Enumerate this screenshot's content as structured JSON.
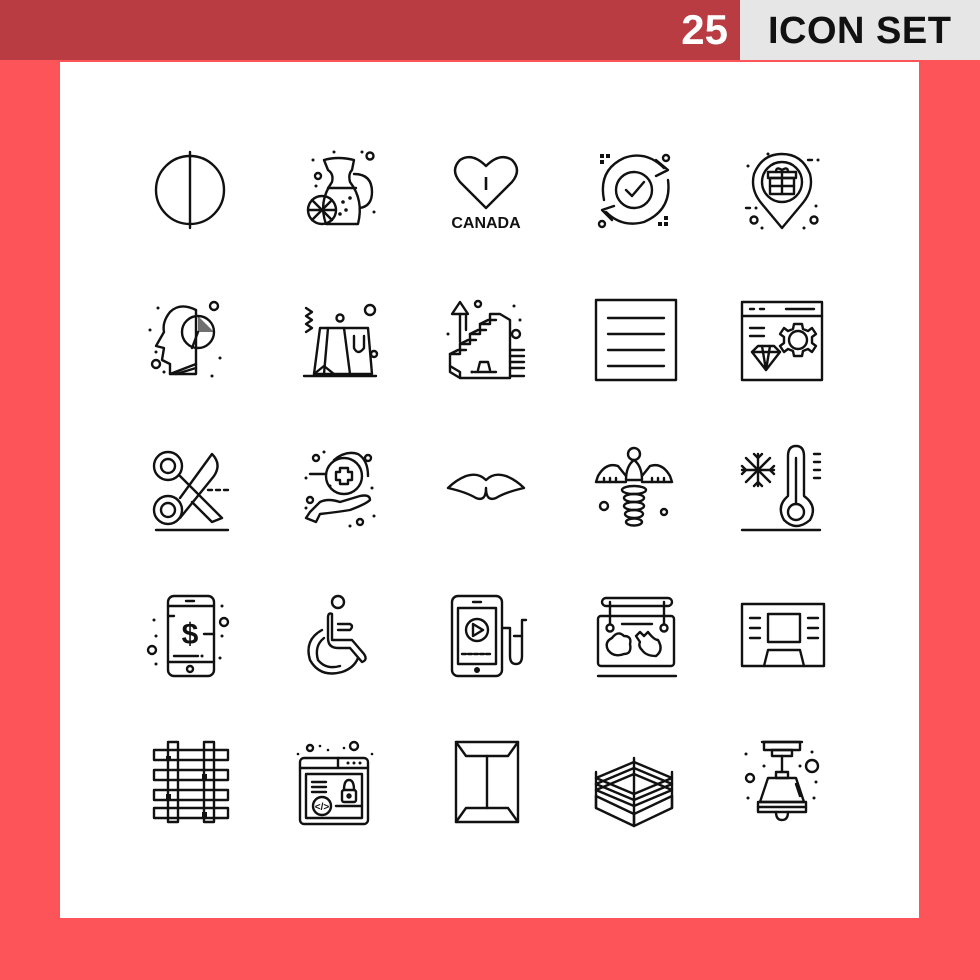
{
  "header": {
    "count": "25",
    "title": "ICON SET"
  },
  "colors": {
    "background": "#fd545a",
    "header_bar": "#b83c42",
    "title_box": "#e6e6e6",
    "panel": "#ffffff",
    "stroke": "#111111"
  },
  "icons": [
    {
      "name": "circle-half-line-icon"
    },
    {
      "name": "lemonade-jug-icon"
    },
    {
      "name": "i-love-canada-heart-icon",
      "text_top": "I",
      "text_bottom": "CANADA"
    },
    {
      "name": "refresh-check-icon"
    },
    {
      "name": "gift-location-pin-icon"
    },
    {
      "name": "head-pie-chart-icon"
    },
    {
      "name": "shopping-bag-icon"
    },
    {
      "name": "stairs-growth-icon"
    },
    {
      "name": "text-document-icon"
    },
    {
      "name": "browser-diamond-gear-icon"
    },
    {
      "name": "scissors-cutting-icon"
    },
    {
      "name": "hand-plus-healthcare-icon"
    },
    {
      "name": "mustache-icon"
    },
    {
      "name": "caduceus-icon"
    },
    {
      "name": "cold-thermometer-snowflake-icon"
    },
    {
      "name": "mobile-dollar-icon",
      "text": "$"
    },
    {
      "name": "wheelchair-icon"
    },
    {
      "name": "mobile-video-headphones-icon"
    },
    {
      "name": "hanging-map-sign-icon"
    },
    {
      "name": "atm-screen-icon"
    },
    {
      "name": "railway-tracks-icon"
    },
    {
      "name": "browser-code-lock-icon",
      "text": "</>"
    },
    {
      "name": "envelope-icon"
    },
    {
      "name": "boxing-ring-icon"
    },
    {
      "name": "ceiling-lamp-icon"
    }
  ]
}
